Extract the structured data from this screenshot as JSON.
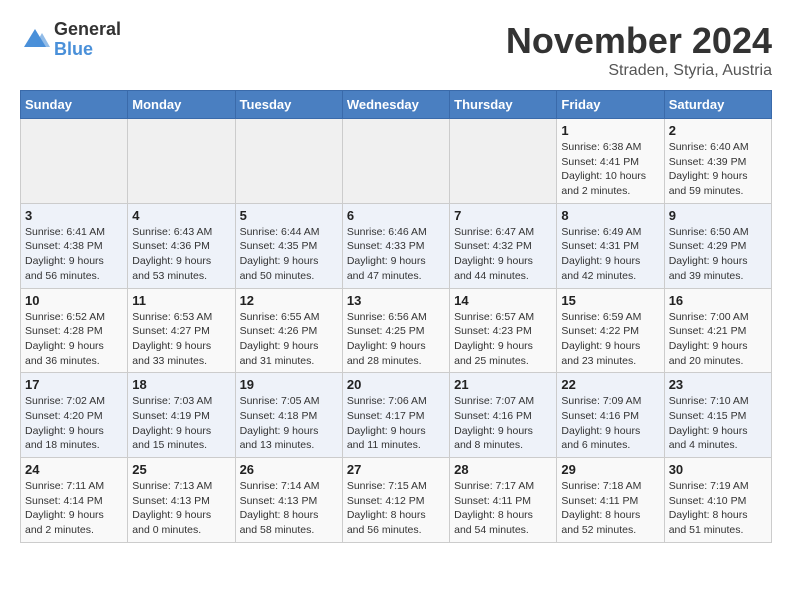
{
  "header": {
    "logo_line1": "General",
    "logo_line2": "Blue",
    "title": "November 2024",
    "subtitle": "Straden, Styria, Austria"
  },
  "weekdays": [
    "Sunday",
    "Monday",
    "Tuesday",
    "Wednesday",
    "Thursday",
    "Friday",
    "Saturday"
  ],
  "weeks": [
    [
      {
        "day": "",
        "info": ""
      },
      {
        "day": "",
        "info": ""
      },
      {
        "day": "",
        "info": ""
      },
      {
        "day": "",
        "info": ""
      },
      {
        "day": "",
        "info": ""
      },
      {
        "day": "1",
        "info": "Sunrise: 6:38 AM\nSunset: 4:41 PM\nDaylight: 10 hours\nand 2 minutes."
      },
      {
        "day": "2",
        "info": "Sunrise: 6:40 AM\nSunset: 4:39 PM\nDaylight: 9 hours\nand 59 minutes."
      }
    ],
    [
      {
        "day": "3",
        "info": "Sunrise: 6:41 AM\nSunset: 4:38 PM\nDaylight: 9 hours\nand 56 minutes."
      },
      {
        "day": "4",
        "info": "Sunrise: 6:43 AM\nSunset: 4:36 PM\nDaylight: 9 hours\nand 53 minutes."
      },
      {
        "day": "5",
        "info": "Sunrise: 6:44 AM\nSunset: 4:35 PM\nDaylight: 9 hours\nand 50 minutes."
      },
      {
        "day": "6",
        "info": "Sunrise: 6:46 AM\nSunset: 4:33 PM\nDaylight: 9 hours\nand 47 minutes."
      },
      {
        "day": "7",
        "info": "Sunrise: 6:47 AM\nSunset: 4:32 PM\nDaylight: 9 hours\nand 44 minutes."
      },
      {
        "day": "8",
        "info": "Sunrise: 6:49 AM\nSunset: 4:31 PM\nDaylight: 9 hours\nand 42 minutes."
      },
      {
        "day": "9",
        "info": "Sunrise: 6:50 AM\nSunset: 4:29 PM\nDaylight: 9 hours\nand 39 minutes."
      }
    ],
    [
      {
        "day": "10",
        "info": "Sunrise: 6:52 AM\nSunset: 4:28 PM\nDaylight: 9 hours\nand 36 minutes."
      },
      {
        "day": "11",
        "info": "Sunrise: 6:53 AM\nSunset: 4:27 PM\nDaylight: 9 hours\nand 33 minutes."
      },
      {
        "day": "12",
        "info": "Sunrise: 6:55 AM\nSunset: 4:26 PM\nDaylight: 9 hours\nand 31 minutes."
      },
      {
        "day": "13",
        "info": "Sunrise: 6:56 AM\nSunset: 4:25 PM\nDaylight: 9 hours\nand 28 minutes."
      },
      {
        "day": "14",
        "info": "Sunrise: 6:57 AM\nSunset: 4:23 PM\nDaylight: 9 hours\nand 25 minutes."
      },
      {
        "day": "15",
        "info": "Sunrise: 6:59 AM\nSunset: 4:22 PM\nDaylight: 9 hours\nand 23 minutes."
      },
      {
        "day": "16",
        "info": "Sunrise: 7:00 AM\nSunset: 4:21 PM\nDaylight: 9 hours\nand 20 minutes."
      }
    ],
    [
      {
        "day": "17",
        "info": "Sunrise: 7:02 AM\nSunset: 4:20 PM\nDaylight: 9 hours\nand 18 minutes."
      },
      {
        "day": "18",
        "info": "Sunrise: 7:03 AM\nSunset: 4:19 PM\nDaylight: 9 hours\nand 15 minutes."
      },
      {
        "day": "19",
        "info": "Sunrise: 7:05 AM\nSunset: 4:18 PM\nDaylight: 9 hours\nand 13 minutes."
      },
      {
        "day": "20",
        "info": "Sunrise: 7:06 AM\nSunset: 4:17 PM\nDaylight: 9 hours\nand 11 minutes."
      },
      {
        "day": "21",
        "info": "Sunrise: 7:07 AM\nSunset: 4:16 PM\nDaylight: 9 hours\nand 8 minutes."
      },
      {
        "day": "22",
        "info": "Sunrise: 7:09 AM\nSunset: 4:16 PM\nDaylight: 9 hours\nand 6 minutes."
      },
      {
        "day": "23",
        "info": "Sunrise: 7:10 AM\nSunset: 4:15 PM\nDaylight: 9 hours\nand 4 minutes."
      }
    ],
    [
      {
        "day": "24",
        "info": "Sunrise: 7:11 AM\nSunset: 4:14 PM\nDaylight: 9 hours\nand 2 minutes."
      },
      {
        "day": "25",
        "info": "Sunrise: 7:13 AM\nSunset: 4:13 PM\nDaylight: 9 hours\nand 0 minutes."
      },
      {
        "day": "26",
        "info": "Sunrise: 7:14 AM\nSunset: 4:13 PM\nDaylight: 8 hours\nand 58 minutes."
      },
      {
        "day": "27",
        "info": "Sunrise: 7:15 AM\nSunset: 4:12 PM\nDaylight: 8 hours\nand 56 minutes."
      },
      {
        "day": "28",
        "info": "Sunrise: 7:17 AM\nSunset: 4:11 PM\nDaylight: 8 hours\nand 54 minutes."
      },
      {
        "day": "29",
        "info": "Sunrise: 7:18 AM\nSunset: 4:11 PM\nDaylight: 8 hours\nand 52 minutes."
      },
      {
        "day": "30",
        "info": "Sunrise: 7:19 AM\nSunset: 4:10 PM\nDaylight: 8 hours\nand 51 minutes."
      }
    ]
  ]
}
